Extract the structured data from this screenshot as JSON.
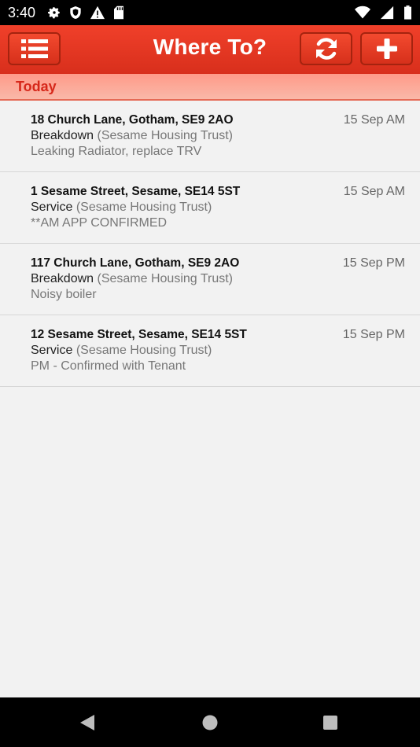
{
  "status_bar": {
    "time": "3:40",
    "left_icons": [
      "gear-icon",
      "shield-icon",
      "warning-icon",
      "sd-card-icon"
    ],
    "right_icons": [
      "wifi-icon",
      "signal-icon",
      "battery-icon"
    ]
  },
  "app_bar": {
    "title": "Where To?",
    "buttons": [
      "menu-list-icon",
      "refresh-icon",
      "plus-icon"
    ],
    "accent_color": "#e5391f"
  },
  "section": {
    "label": "Today"
  },
  "jobs": [
    {
      "address": "18 Church Lane, Gotham, SE9 2AO",
      "time": "15 Sep AM",
      "type": "Breakdown",
      "org": "(Sesame Housing Trust)",
      "note": "Leaking Radiator, replace TRV"
    },
    {
      "address": "1 Sesame Street, Sesame, SE14 5ST",
      "time": "15 Sep AM",
      "type": "Service",
      "org": "(Sesame Housing Trust)",
      "note": "**AM APP CONFIRMED"
    },
    {
      "address": "117 Church Lane, Gotham, SE9 2AO",
      "time": "15 Sep PM",
      "type": "Breakdown",
      "org": "(Sesame Housing Trust)",
      "note": "Noisy boiler"
    },
    {
      "address": "12 Sesame Street, Sesame, SE14 5ST",
      "time": "15 Sep PM",
      "type": "Service",
      "org": "(Sesame Housing Trust)",
      "note": "PM - Confirmed with Tenant"
    }
  ],
  "nav_bar": {
    "buttons": [
      "back-icon",
      "home-icon",
      "recents-icon"
    ]
  }
}
